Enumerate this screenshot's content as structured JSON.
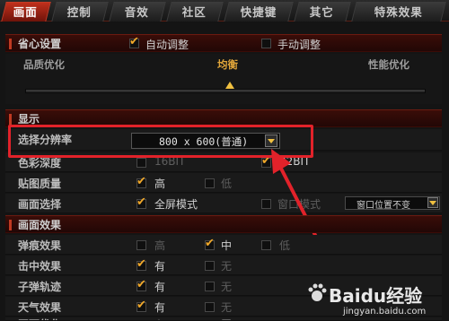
{
  "tabs": [
    "画面",
    "控制",
    "音效",
    "社区",
    "快捷键",
    "其它",
    "特殊效果"
  ],
  "preset": {
    "label": "省心设置",
    "auto": "自动调整",
    "manual": "手动调整",
    "quality": "品质优化",
    "balanced": "均衡",
    "performance": "性能优化"
  },
  "display": {
    "title": "显示",
    "resolution_label": "选择分辨率",
    "resolution_value": "800 x 600(普通)",
    "color_depth_label": "色彩深度",
    "color_16": "16BIT",
    "color_32": "32BIT",
    "texture_label": "贴图质量",
    "high": "高",
    "low": "低",
    "window_label": "画面选择",
    "fullscreen": "全屏模式",
    "windowed": "窗口模式",
    "window_position": "窗口位置不变"
  },
  "effects": {
    "title": "画面效果",
    "rows": [
      {
        "label": "弹痕效果",
        "options": [
          "高",
          "中",
          "低"
        ],
        "checked": 1
      },
      {
        "label": "击中效果",
        "options": [
          "有",
          "无"
        ],
        "checked": 0
      },
      {
        "label": "子弹轨迹",
        "options": [
          "有",
          "无"
        ],
        "checked": 0
      },
      {
        "label": "天气效果",
        "options": [
          "有",
          "无"
        ],
        "checked": 0
      },
      {
        "label": "画面优化",
        "options": [
          "有",
          "无"
        ],
        "checked": 1
      }
    ]
  },
  "watermark": {
    "brand": "Baidu经验",
    "url": "jingyan.baidu.com"
  },
  "colors": {
    "accent": "#c43a25",
    "highlight": "#e2222a",
    "check": "#f0a82a"
  }
}
